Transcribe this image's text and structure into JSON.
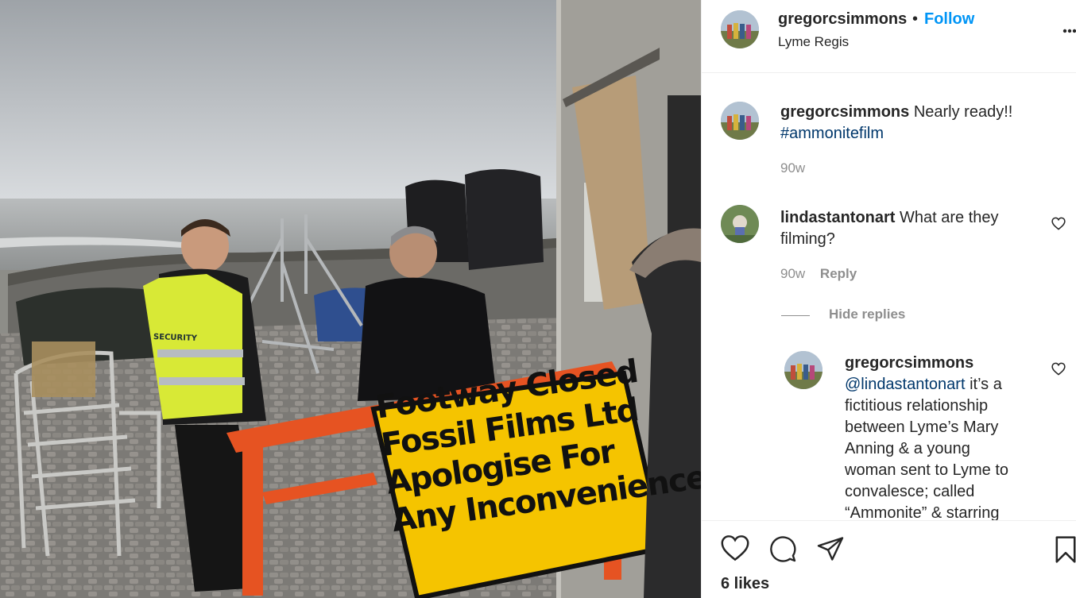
{
  "post": {
    "author": "gregorcsimmons",
    "separator": "•",
    "follow_label": "Follow",
    "location": "Lyme Regis",
    "more_icon": "more-horizontal-icon"
  },
  "photo": {
    "sign_lines": [
      "Footway Closed",
      "Fossil Films Ltd",
      "Apologise For",
      "Any Inconvenience"
    ],
    "vest_label": "SECURITY"
  },
  "comments": [
    {
      "user": "gregorcsimmons",
      "text": "Nearly ready!!",
      "hashtag": "#ammonitefilm",
      "time": "90w"
    },
    {
      "user": "lindastantonart",
      "text": "What are they filming?",
      "time": "90w",
      "reply_label": "Reply"
    }
  ],
  "replies_toggle": "Hide replies",
  "reply": {
    "user": "gregorcsimmons",
    "mention": "@lindastantonart",
    "text_lines": [
      "it’s a",
      "fictitious relationship",
      "between Lyme’s Mary",
      "Anning & a young",
      "woman sent to Lyme to",
      "convalesce; called",
      "“Ammonite” & starring"
    ]
  },
  "actions": {
    "like_icon": "heart-icon",
    "comment_icon": "comment-icon",
    "share_icon": "send-icon",
    "save_icon": "bookmark-icon"
  },
  "likes_label": "6 likes",
  "colors": {
    "follow": "#0095f6",
    "link": "#00376b",
    "muted": "#8e8e8e"
  }
}
